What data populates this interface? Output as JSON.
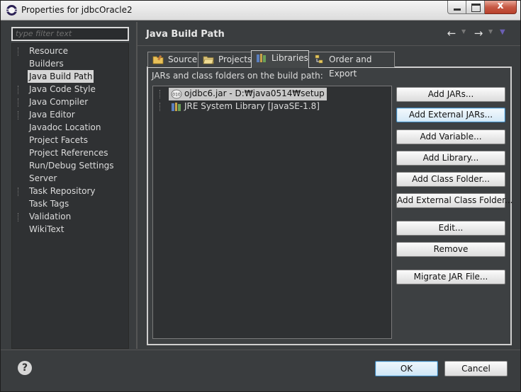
{
  "window": {
    "title": "Properties for jdbcOracle2",
    "close_glyph": "x"
  },
  "left": {
    "filter_placeholder": "type filter text",
    "items": [
      {
        "label": "Resource",
        "expandable": true
      },
      {
        "label": "Builders",
        "expandable": false
      },
      {
        "label": "Java Build Path",
        "expandable": false,
        "selected": true
      },
      {
        "label": "Java Code Style",
        "expandable": true
      },
      {
        "label": "Java Compiler",
        "expandable": true
      },
      {
        "label": "Java Editor",
        "expandable": true
      },
      {
        "label": "Javadoc Location",
        "expandable": false
      },
      {
        "label": "Project Facets",
        "expandable": false
      },
      {
        "label": "Project References",
        "expandable": false
      },
      {
        "label": "Run/Debug Settings",
        "expandable": false
      },
      {
        "label": "Server",
        "expandable": false
      },
      {
        "label": "Task Repository",
        "expandable": true
      },
      {
        "label": "Task Tags",
        "expandable": false
      },
      {
        "label": "Validation",
        "expandable": true
      },
      {
        "label": "WikiText",
        "expandable": false
      }
    ]
  },
  "page": {
    "title": "Java Build Path",
    "tabs": [
      {
        "label": "Source",
        "icon": "source-folder-icon"
      },
      {
        "label": "Projects",
        "icon": "projects-folder-icon"
      },
      {
        "label": "Libraries",
        "icon": "libraries-icon",
        "active": true
      },
      {
        "label": "Order and Export",
        "icon": "order-export-icon"
      }
    ],
    "libraries_label": "JARs and class folders on the build path:",
    "entries": [
      {
        "label": "ojdbc6.jar - D:₩java0514₩setup",
        "icon": "jar-icon",
        "selected": true
      },
      {
        "label": "JRE System Library [JavaSE-1.8]",
        "icon": "library-icon",
        "selected": false
      }
    ],
    "buttons": {
      "add_jars": "Add JARs...",
      "add_external_jars": "Add External JARs...",
      "add_variable": "Add Variable...",
      "add_library": "Add Library...",
      "add_class_folder": "Add Class Folder...",
      "add_external_class_folder": "Add External Class Folder...",
      "edit": "Edit...",
      "remove": "Remove",
      "migrate": "Migrate JAR File..."
    }
  },
  "footer": {
    "help_glyph": "?",
    "ok": "OK",
    "cancel": "Cancel"
  },
  "colors": {
    "background": "#3a3d3f",
    "selection": "#d5d5d5",
    "focus_border": "#3c7fb1"
  }
}
